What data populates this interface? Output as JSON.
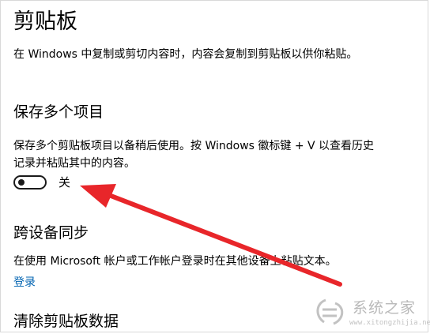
{
  "page": {
    "title": "剪贴板",
    "description": "在 Windows 中复制或剪切内容时，内容会复制到剪贴板以供你粘贴。"
  },
  "history": {
    "title": "保存多个项目",
    "description": "保存多个剪贴板项目以备稍后使用。按 Windows 徽标键 + V 以查看历史记录并粘贴其中的内容。",
    "toggle_state": "关",
    "toggle_on": false
  },
  "sync": {
    "title": "跨设备同步",
    "description": "在使用 Microsoft 帐户或工作帐户登录时在其他设备上粘贴文本。",
    "signin_link": "登录"
  },
  "clear": {
    "title": "清除剪贴板数据"
  },
  "watermark": {
    "text": "系统之家",
    "url": "www.xitongzhijia.net"
  },
  "colors": {
    "link": "#0063b1",
    "arrow": "#e8262a",
    "text": "#000000"
  },
  "icons": {
    "annotation": "red-arrow-icon",
    "watermark": "xitongzhijia-logo-icon"
  }
}
